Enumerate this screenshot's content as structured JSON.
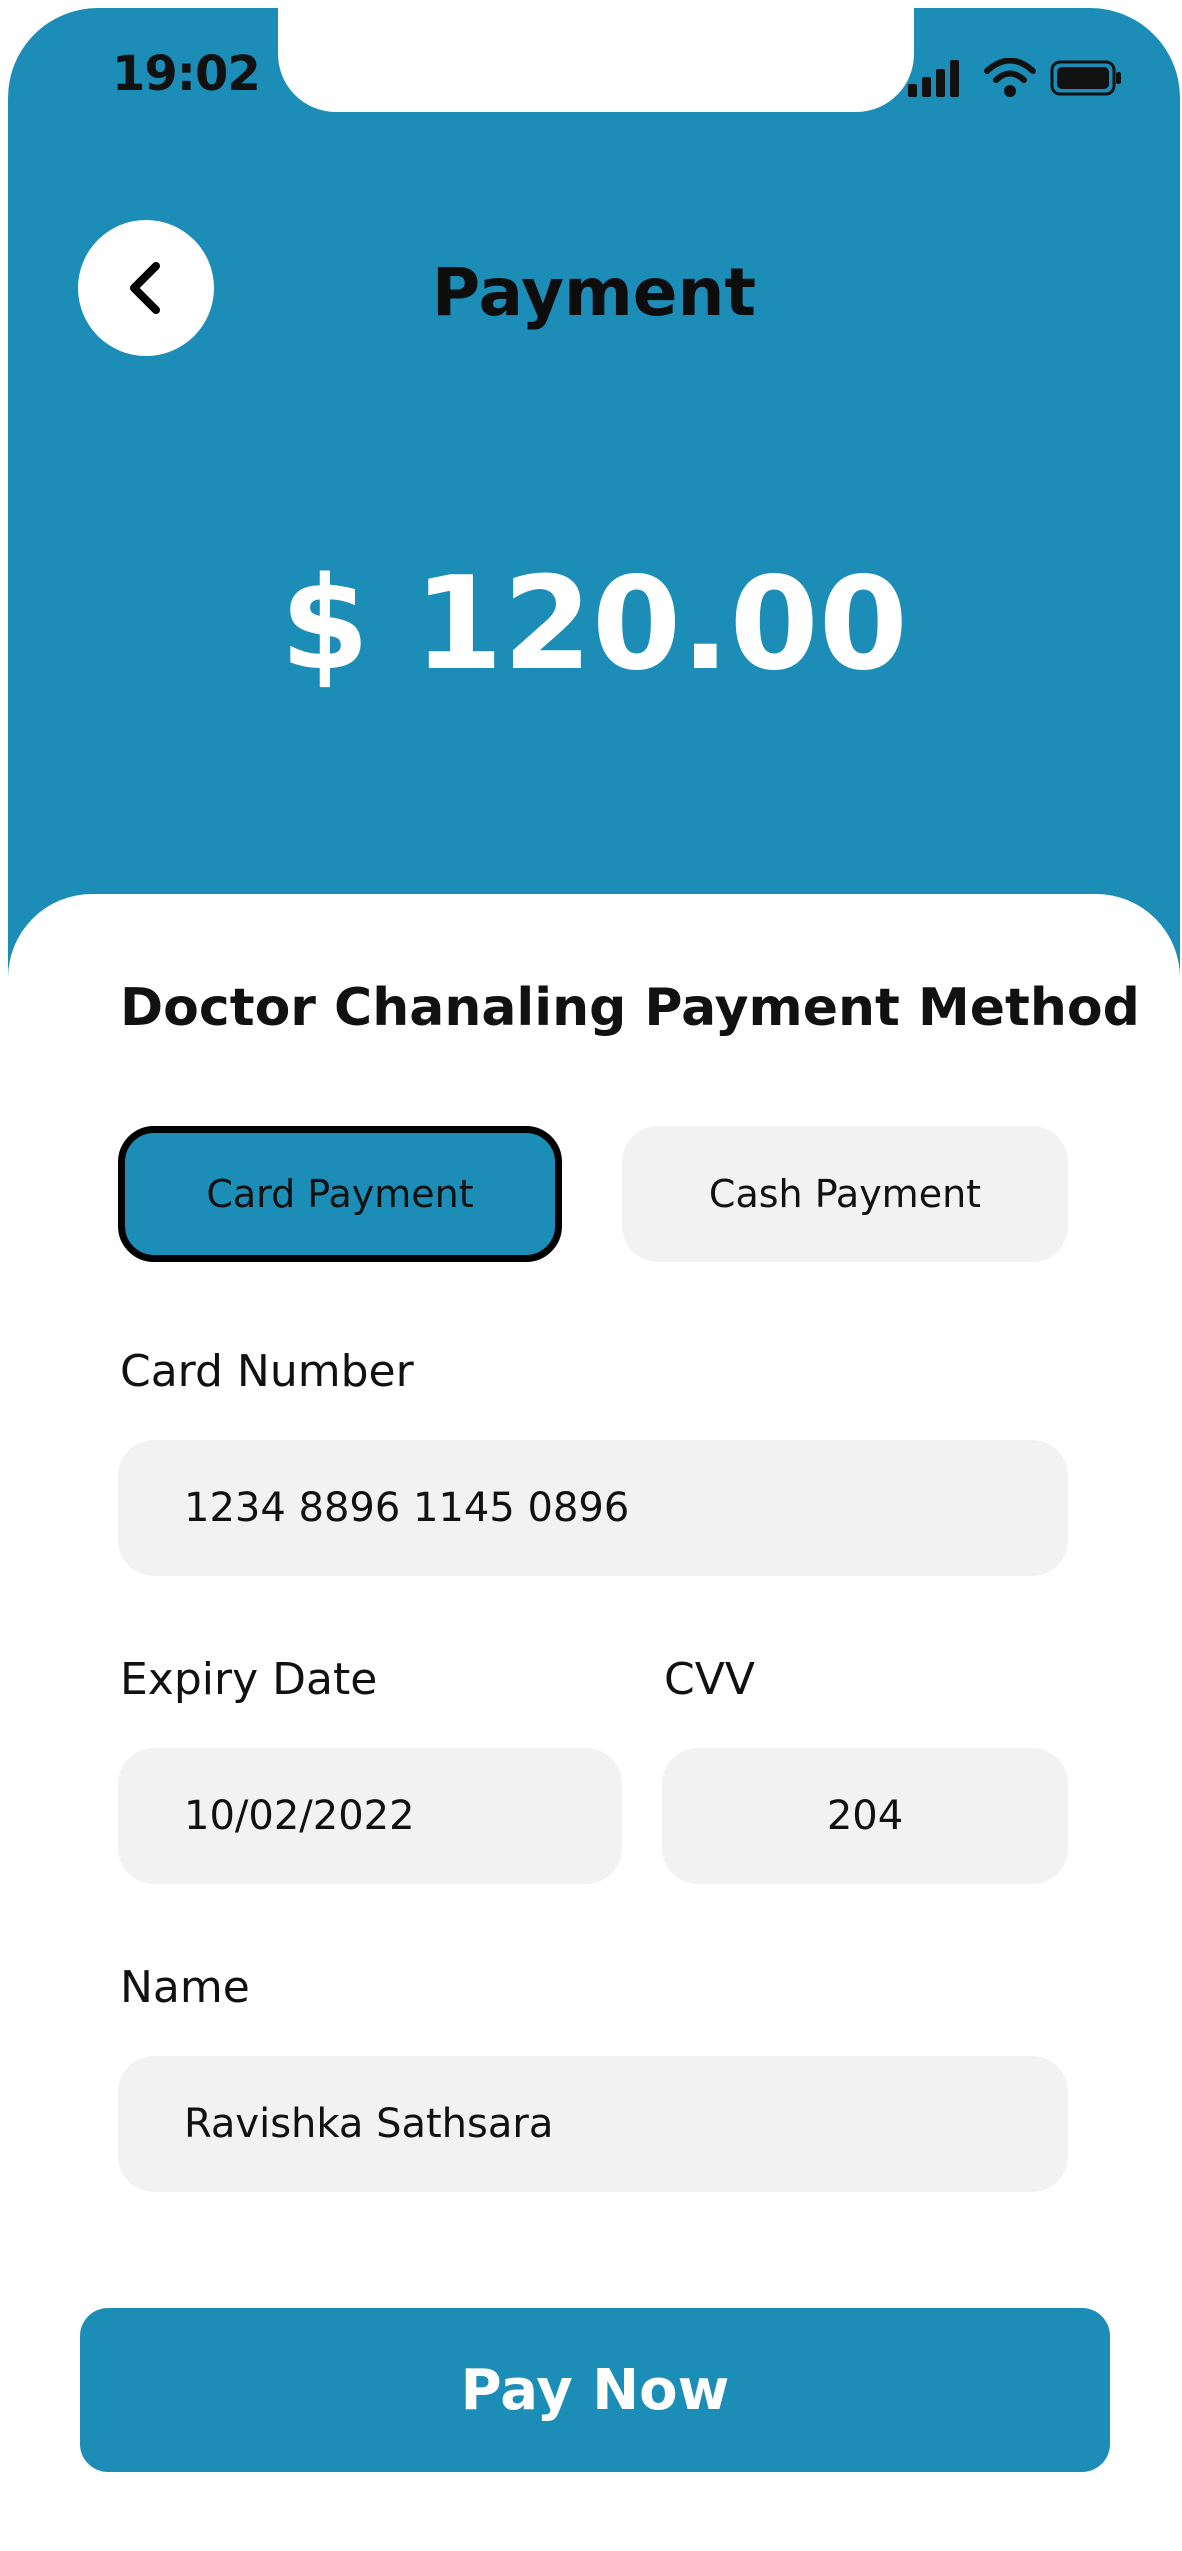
{
  "status_bar": {
    "time": "19:02",
    "icons": [
      "signal-icon",
      "wifi-icon",
      "battery-icon"
    ]
  },
  "header": {
    "back_icon": "chevron-left-icon",
    "title": "Payment",
    "amount": "$ 120.00"
  },
  "payment_method": {
    "title": "Doctor Chanaling Payment Method",
    "options": [
      {
        "label": "Card Payment",
        "selected": true
      },
      {
        "label": "Cash Payment",
        "selected": false
      }
    ]
  },
  "form": {
    "card_number": {
      "label": "Card Number",
      "value": "1234 8896 1145 0896"
    },
    "expiry_date": {
      "label": "Expiry Date",
      "value": "10/02/2022"
    },
    "cvv": {
      "label": "CVV",
      "value": "204"
    },
    "name": {
      "label": "Name",
      "value": "Ravishka Sathsara"
    }
  },
  "actions": {
    "pay_label": "Pay Now"
  },
  "colors": {
    "accent": "#1b8db6",
    "field_background": "#f2f2f2",
    "text": "#111111"
  }
}
